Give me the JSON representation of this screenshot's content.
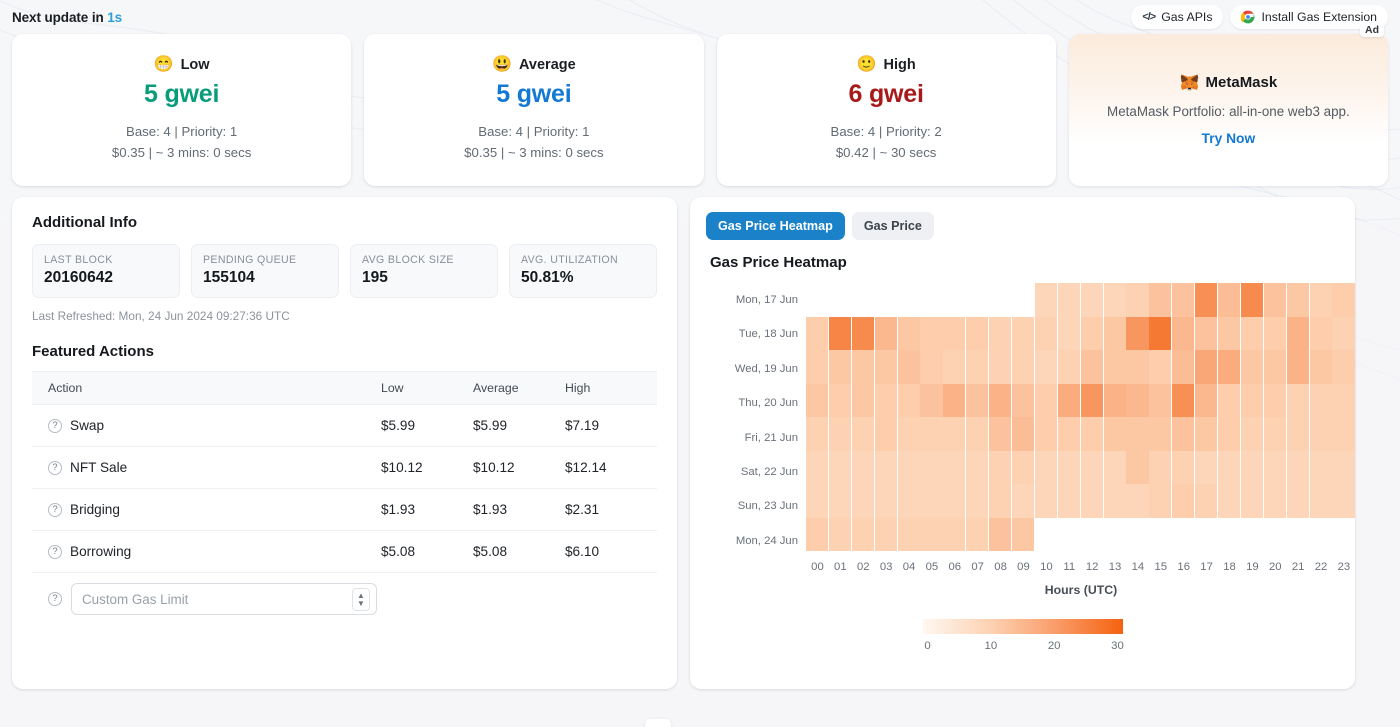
{
  "topbar": {
    "next_update_prefix": "Next update in ",
    "next_update_value": "1s",
    "gas_apis_label": "Gas APIs",
    "gas_apis_glyph": "</>",
    "install_extension_label": "Install Gas Extension"
  },
  "gas_cards": [
    {
      "label": "Low",
      "emoji": "😁",
      "emoji_name": "grinning-face-emoji",
      "price": "5 gwei",
      "color": "#089c7a",
      "detail_1": "Base: 4 | Priority: 1",
      "detail_2": "$0.35 | ~ 3 mins: 0 secs"
    },
    {
      "label": "Average",
      "emoji": "😃",
      "emoji_name": "smiling-face-open-mouth-emoji",
      "price": "5 gwei",
      "color": "#1479d4",
      "detail_1": "Base: 4 | Priority: 1",
      "detail_2": "$0.35 | ~ 3 mins: 0 secs"
    },
    {
      "label": "High",
      "emoji": "🙂",
      "emoji_name": "slightly-smiling-face-emoji",
      "price": "6 gwei",
      "color": "#a81a1a",
      "detail_1": "Base: 4 | Priority: 2",
      "detail_2": "$0.42 | ~ 30 secs"
    }
  ],
  "ad": {
    "tag": "Ad",
    "brand": "MetaMask",
    "description": "MetaMask Portfolio: all-in-one web3 app.",
    "cta": "Try Now"
  },
  "additional_info": {
    "title": "Additional Info",
    "stats": [
      {
        "label": "LAST BLOCK",
        "value": "20160642"
      },
      {
        "label": "PENDING QUEUE",
        "value": "155104"
      },
      {
        "label": "AVG BLOCK SIZE",
        "value": "195"
      },
      {
        "label": "AVG. UTILIZATION",
        "value": "50.81%"
      }
    ],
    "last_refreshed": "Last Refreshed: Mon, 24 Jun 2024 09:27:36 UTC"
  },
  "featured_actions": {
    "title": "Featured Actions",
    "columns": [
      "Action",
      "Low",
      "Average",
      "High"
    ],
    "rows": [
      {
        "action": "Swap",
        "low": "$5.99",
        "average": "$5.99",
        "high": "$7.19"
      },
      {
        "action": "NFT Sale",
        "low": "$10.12",
        "average": "$10.12",
        "high": "$12.14"
      },
      {
        "action": "Bridging",
        "low": "$1.93",
        "average": "$1.93",
        "high": "$2.31"
      },
      {
        "action": "Borrowing",
        "low": "$5.08",
        "average": "$5.08",
        "high": "$6.10"
      }
    ],
    "custom_gas_placeholder": "Custom Gas Limit",
    "custom_gas_value": ""
  },
  "chart_panel": {
    "tabs": [
      {
        "label": "Gas Price Heatmap",
        "active": true
      },
      {
        "label": "Gas Price",
        "active": false
      }
    ]
  },
  "chart_data": {
    "type": "heatmap",
    "title": "Gas Price Heatmap",
    "xlabel": "Hours (UTC)",
    "ylabel": "",
    "x": [
      "00",
      "01",
      "02",
      "03",
      "04",
      "05",
      "06",
      "07",
      "08",
      "09",
      "10",
      "11",
      "12",
      "13",
      "14",
      "15",
      "16",
      "17",
      "18",
      "19",
      "20",
      "21",
      "22",
      "23"
    ],
    "y": [
      "Mon, 17 Jun",
      "Tue, 18 Jun",
      "Wed, 19 Jun",
      "Thu, 20 Jun",
      "Fri, 21 Jun",
      "Sat, 22 Jun",
      "Sun, 23 Jun",
      "Mon, 24 Jun"
    ],
    "colorscale": [
      "#fff7f1",
      "#fdd3b4",
      "#f99d6a",
      "#f4620f"
    ],
    "zlim": [
      0,
      30
    ],
    "legend_ticks": [
      "0",
      "10",
      "20",
      "30"
    ],
    "legend_position": "bottom",
    "values": [
      [
        null,
        null,
        null,
        null,
        null,
        null,
        null,
        null,
        null,
        null,
        9,
        9,
        9,
        9,
        10,
        13,
        13,
        22,
        14,
        23,
        13,
        12,
        10,
        11
      ],
      [
        11,
        24,
        23,
        15,
        12,
        11,
        11,
        11,
        10,
        10,
        10,
        9,
        11,
        12,
        21,
        26,
        15,
        13,
        12,
        11,
        11,
        16,
        11,
        10
      ],
      [
        11,
        12,
        12,
        12,
        13,
        11,
        10,
        10,
        10,
        10,
        9,
        10,
        13,
        12,
        12,
        11,
        14,
        18,
        17,
        12,
        12,
        16,
        12,
        11
      ],
      [
        12,
        11,
        12,
        11,
        11,
        13,
        16,
        13,
        16,
        13,
        11,
        17,
        21,
        16,
        15,
        13,
        22,
        15,
        11,
        11,
        11,
        10,
        10,
        10
      ],
      [
        10,
        10,
        10,
        11,
        10,
        10,
        10,
        10,
        13,
        14,
        11,
        11,
        11,
        12,
        12,
        12,
        13,
        12,
        11,
        10,
        10,
        10,
        10,
        10
      ],
      [
        9,
        9,
        9,
        9,
        9,
        9,
        9,
        9,
        10,
        10,
        9,
        9,
        9,
        9,
        12,
        10,
        10,
        9,
        9,
        9,
        9,
        9,
        9,
        9
      ],
      [
        9,
        9,
        9,
        9,
        9,
        9,
        9,
        9,
        10,
        9,
        9,
        9,
        9,
        9,
        9,
        10,
        11,
        10,
        9,
        9,
        9,
        9,
        9,
        9
      ],
      [
        11,
        10,
        10,
        10,
        10,
        10,
        10,
        10,
        13,
        12,
        null,
        null,
        null,
        null,
        null,
        null,
        null,
        null,
        null,
        null,
        null,
        null,
        null,
        null
      ]
    ]
  }
}
